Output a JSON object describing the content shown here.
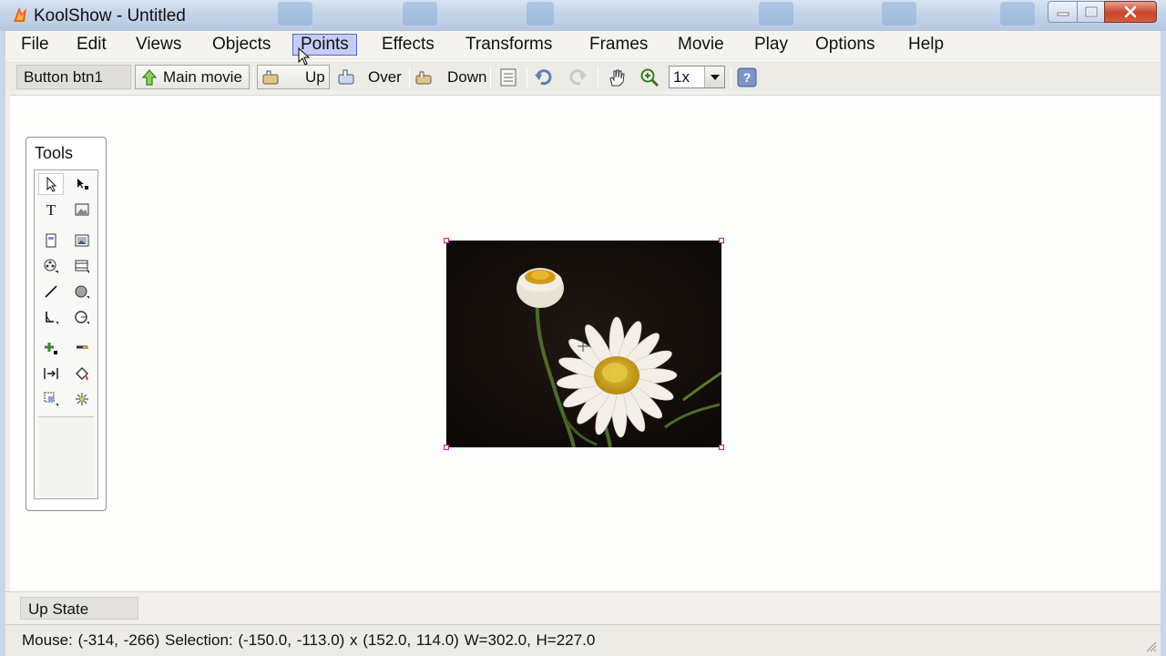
{
  "window": {
    "title": "KoolShow - Untitled"
  },
  "menu": {
    "items": [
      "File",
      "Edit",
      "Views",
      "Objects",
      "Points",
      "Effects",
      "Transforms",
      "Frames",
      "Movie",
      "Play",
      "Options",
      "Help"
    ],
    "active": "Points"
  },
  "toolbar": {
    "object_name": "Button btn1",
    "main_movie_label": "Main movie",
    "up_label": "Up",
    "over_label": "Over",
    "down_label": "Down",
    "zoom_value": "1x"
  },
  "tools": {
    "title": "Tools",
    "items": [
      {
        "icon": "arrow-select-icon",
        "selected": true
      },
      {
        "icon": "point-select-icon"
      },
      {
        "icon": "text-tool-icon",
        "glyph": "T"
      },
      {
        "icon": "image-tool-icon"
      },
      {
        "icon": "frame-tool-icon"
      },
      {
        "icon": "picture-frame-icon"
      },
      {
        "icon": "film-reel-icon"
      },
      {
        "icon": "movie-clip-icon"
      },
      {
        "icon": "line-tool-icon"
      },
      {
        "icon": "ellipse-tool-icon"
      },
      {
        "icon": "polyline-tool-icon"
      },
      {
        "icon": "shape-tool-icon"
      },
      {
        "icon": "add-point-icon"
      },
      {
        "icon": "remove-point-icon"
      },
      {
        "icon": "align-tool-icon"
      },
      {
        "icon": "fill-bucket-icon"
      },
      {
        "icon": "transform-tool-icon"
      },
      {
        "icon": "sparkle-effect-icon"
      }
    ]
  },
  "state": {
    "label": "Up State"
  },
  "status": {
    "text": "Mouse: (-314, -266)  Selection: (-150.0, -113.0) x (152.0, 114.0)  W=302.0,  H=227.0"
  },
  "colors": {
    "menu_highlight": "#c5cdf4",
    "selection_handle": "#c0179a",
    "close_button": "#c8452d"
  }
}
